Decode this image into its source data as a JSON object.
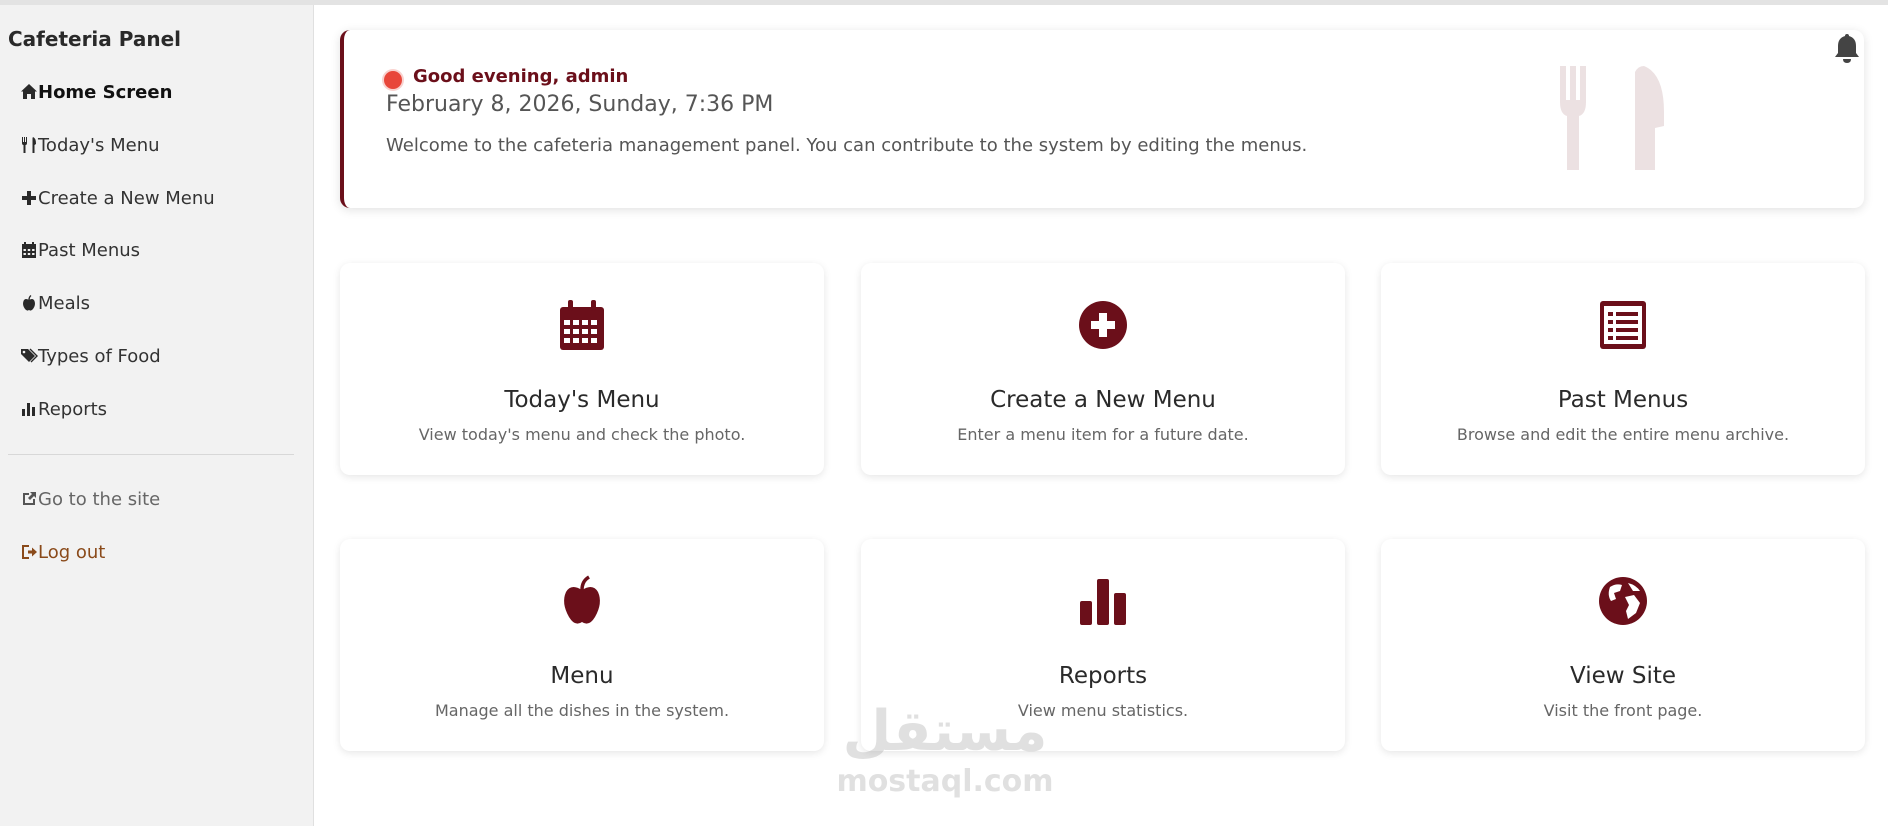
{
  "sidebar": {
    "title": "Cafeteria Panel",
    "items": [
      {
        "label": "Home Screen",
        "icon": "home-icon"
      },
      {
        "label": "Today's Menu",
        "icon": "utensils-icon"
      },
      {
        "label": "Create a New Menu",
        "icon": "plus-icon"
      },
      {
        "label": "Past Menus",
        "icon": "calendar-icon"
      },
      {
        "label": "Meals",
        "icon": "apple-icon"
      },
      {
        "label": "Types of Food",
        "icon": "tags-icon"
      },
      {
        "label": "Reports",
        "icon": "bar-chart-icon"
      }
    ],
    "footer_items": [
      {
        "label": "Go to the site",
        "icon": "external-link-icon"
      },
      {
        "label": "Log out",
        "icon": "sign-out-icon"
      }
    ]
  },
  "welcome": {
    "greeting": "Good evening, admin",
    "datetime": "February 8, 2026, Sunday, 7:36 PM",
    "text": "Welcome to the cafeteria management panel. You can contribute to the system by editing the menus."
  },
  "cards": [
    {
      "title": "Today's Menu",
      "description": "View today's menu and check the photo.",
      "icon": "calendar-icon"
    },
    {
      "title": "Create a New Menu",
      "description": "Enter a menu item for a future date.",
      "icon": "plus-circle-icon"
    },
    {
      "title": "Past Menus",
      "description": "Browse and edit the entire menu archive.",
      "icon": "list-alt-icon"
    },
    {
      "title": "Menu",
      "description": "Manage all the dishes in the system.",
      "icon": "apple-icon"
    },
    {
      "title": "Reports",
      "description": "View menu statistics.",
      "icon": "bar-chart-icon"
    },
    {
      "title": "View Site",
      "description": "Visit the front page.",
      "icon": "globe-icon"
    }
  ],
  "watermark": {
    "arabic": "مستقل",
    "text": "mostaql.com"
  },
  "colors": {
    "accent": "#6b0f1a",
    "status_dot": "#e8463a",
    "sidebar_bg": "#f2f2f2",
    "logout": "#8a4a1a"
  }
}
